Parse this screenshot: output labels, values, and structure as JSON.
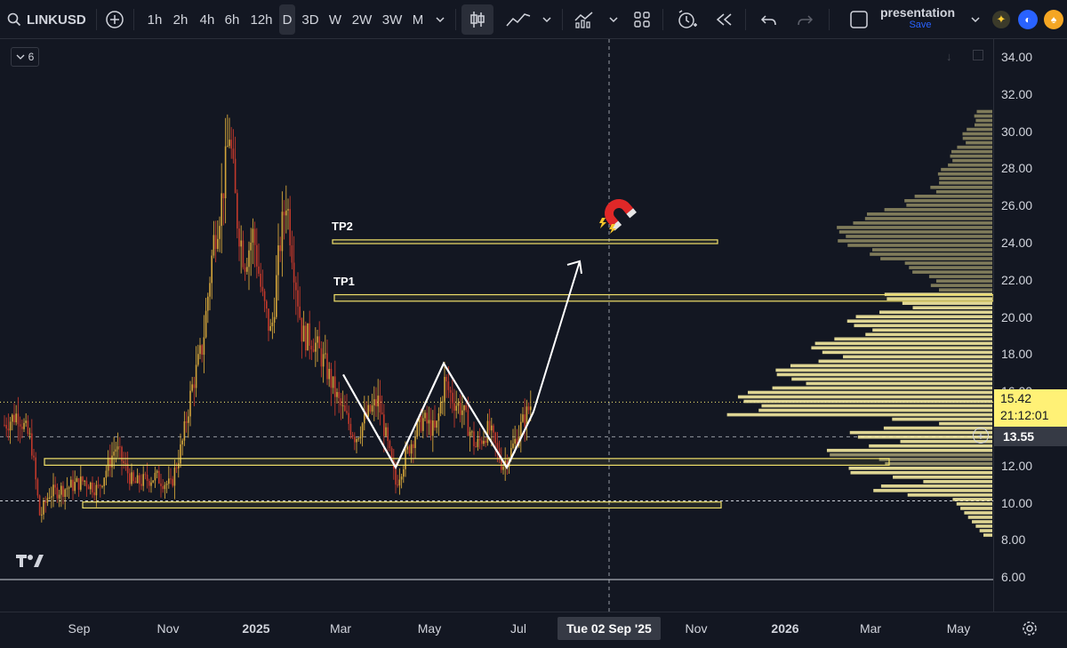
{
  "toolbar": {
    "symbol": "LINKUSD",
    "intervals": [
      "1h",
      "2h",
      "4h",
      "6h",
      "12h",
      "D",
      "3D",
      "W",
      "2W",
      "3W",
      "M"
    ],
    "active_interval": "D",
    "layout_name": "presentation",
    "save_label": "Save"
  },
  "indicator_badge": "6",
  "price_axis": {
    "ticks": [
      "34.00",
      "32.00",
      "30.00",
      "28.00",
      "26.00",
      "24.00",
      "22.00",
      "20.00",
      "18.00",
      "16.00",
      "14.00",
      "12.00",
      "10.00",
      "8.00",
      "6.00"
    ],
    "current_price": "15.42",
    "countdown": "21:12:01",
    "crosshair_price": "13.55"
  },
  "time_axis": {
    "labels": [
      "Sep",
      "Nov",
      "2025",
      "Mar",
      "May",
      "Jul",
      "Nov",
      "2026",
      "Mar",
      "May"
    ],
    "bold_labels": [
      "2025",
      "2026"
    ],
    "crosshair_date": "Tue 02 Sep '25"
  },
  "annotations": {
    "tp1": "TP1",
    "tp2": "TP2"
  },
  "colors": {
    "background": "#131722",
    "candle": "#d4a53a",
    "zone_border": "#f0e06a",
    "volume_profile_upper": "#8c8660",
    "volume_profile_lower": "#f5eaa0",
    "price_label_bg": "#fff176",
    "arrow": "#ffffff"
  },
  "icons": [
    "search-icon",
    "add-symbol-icon",
    "candles-icon",
    "line-chart-icon",
    "indicators-icon",
    "layouts-icon",
    "alert-icon",
    "replay-icon",
    "undo-icon",
    "redo-icon",
    "layout-checkbox-icon",
    "settings-icon",
    "magnet-icon"
  ]
}
